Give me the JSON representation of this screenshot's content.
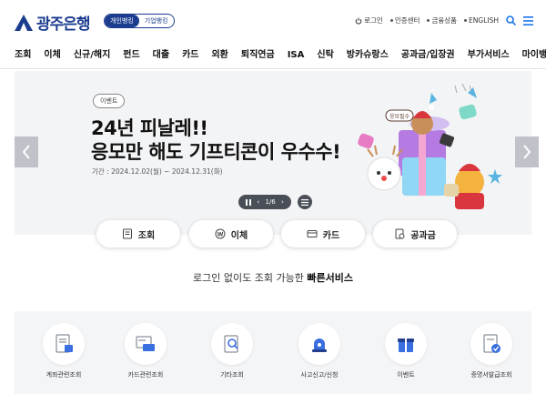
{
  "header": {
    "logo_text": "광주은행",
    "bank_types": [
      "개인뱅킹",
      "기업뱅킹"
    ],
    "util": [
      "로그인",
      "인증센터",
      "금융상품",
      "ENGLISH"
    ]
  },
  "gnb": [
    "조회",
    "이체",
    "신규/해지",
    "펀드",
    "대출",
    "카드",
    "외환",
    "퇴직연금",
    "ISA",
    "신탁",
    "방카슈랑스",
    "공과금/입장권",
    "부가서비스",
    "마이뱅킹관리"
  ],
  "banner": {
    "badge": "이벤트",
    "title_line1": "24년 피날레!!",
    "title_line2": "응모만 해도 기프티콘이 우수수!",
    "period": "기간 : 2024.12.02(월) ~ 2024.12.31(화)",
    "pager": "1/6",
    "sign_text": "응모필수"
  },
  "quick": [
    "조회",
    "이체",
    "카드",
    "공과금"
  ],
  "service_title_prefix": "로그인 없이도 조회 가능한 ",
  "service_title_bold": "빠른서비스",
  "services": [
    "계좌관련조회",
    "카드관련조회",
    "기타조회",
    "사고신고/신청",
    "이벤트",
    "증명서발급조회"
  ],
  "colors": {
    "brand": "#1b3c8f",
    "accent": "#1a73e8"
  }
}
